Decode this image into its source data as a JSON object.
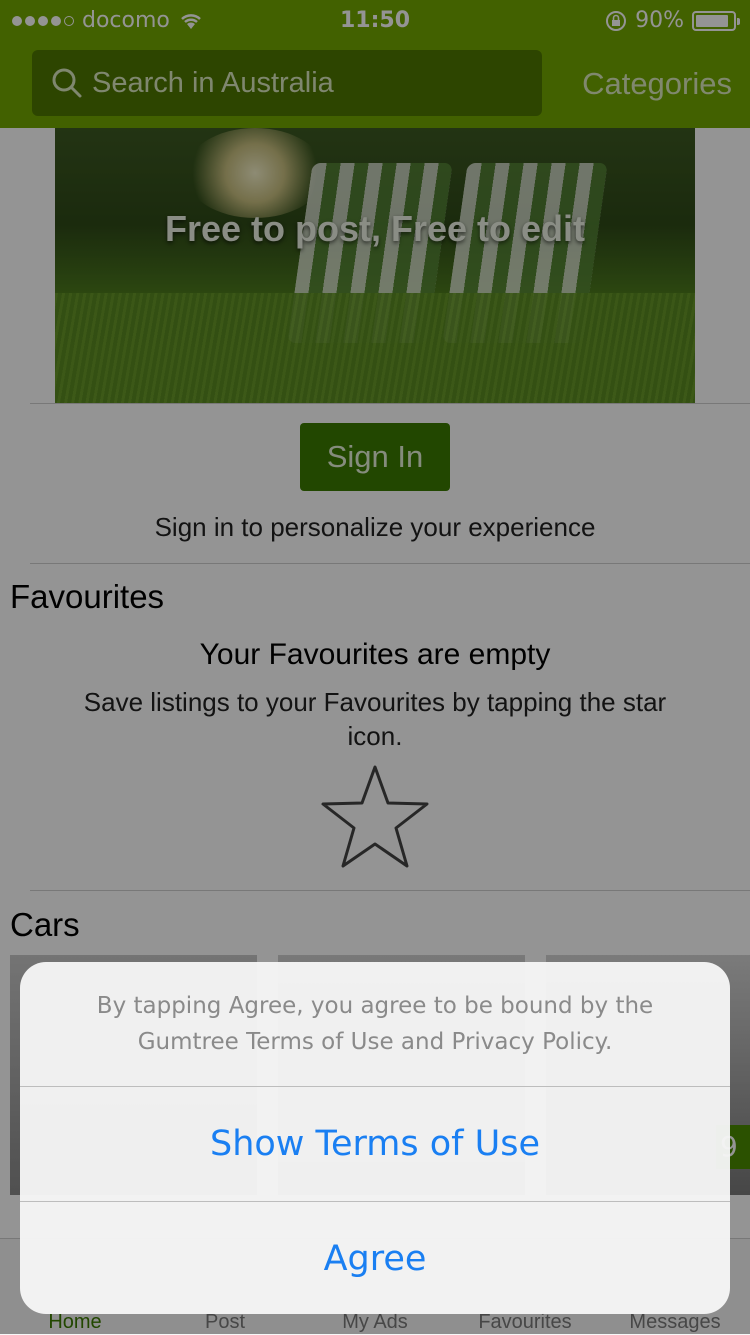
{
  "status_bar": {
    "carrier": "docomo",
    "time": "11:50",
    "battery": "90%",
    "battery_level": 0.9,
    "icons": [
      "signal-dots",
      "wifi-icon",
      "rotation-lock-icon",
      "battery-icon"
    ]
  },
  "header": {
    "search_placeholder": "Search in Australia",
    "categories_label": "Categories"
  },
  "banner": {
    "text": "Free to post, Free to edit"
  },
  "sign_in": {
    "button_label": "Sign In",
    "prompt": "Sign in to personalize your experience"
  },
  "favourites": {
    "section_title": "Favourites",
    "empty_title": "Your Favourites are empty",
    "empty_description": "Save listings to your Favourites by tapping the star icon.",
    "icon": "star-icon"
  },
  "cars": {
    "section_title": "Cars",
    "partial_price": "9"
  },
  "tab_bar": {
    "items": [
      {
        "label": "Home",
        "active": true
      },
      {
        "label": "Post",
        "active": false
      },
      {
        "label": "My Ads",
        "active": false
      },
      {
        "label": "Favourites",
        "active": false
      },
      {
        "label": "Messages",
        "active": false
      }
    ]
  },
  "alert": {
    "message": "By tapping Agree, you agree to be bound by the Gumtree Terms of Use and Privacy Policy.",
    "show_terms_label": "Show Terms of Use",
    "agree_label": "Agree"
  },
  "colors": {
    "brand_green": "#73a800",
    "button_green": "#3c7b00",
    "alert_button_blue": "#1a7ff2"
  }
}
